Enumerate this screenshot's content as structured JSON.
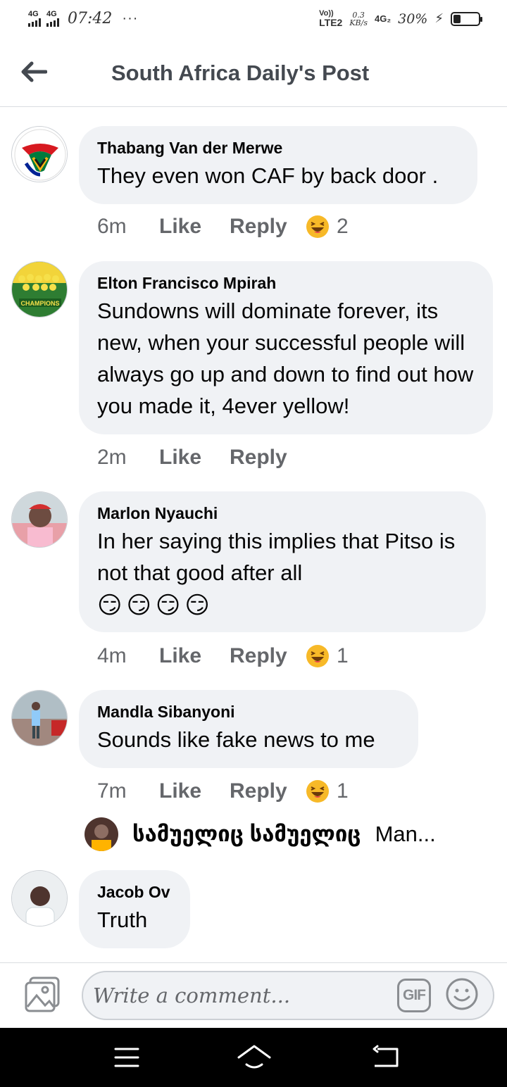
{
  "status_bar": {
    "sim1": "4G",
    "sim2": "4G",
    "time": "07:42",
    "dots": "···",
    "volte_top": "Vo))",
    "volte_bottom": "LTE2",
    "speed_value": "0.3",
    "speed_unit": "KB/s",
    "net_type": "4G₂",
    "battery_percent": "30%",
    "battery_level": 0.3
  },
  "header": {
    "title": "South Africa Daily's Post"
  },
  "comments": [
    {
      "author": "Thabang Van der Merwe",
      "text": "They even won CAF by back door .",
      "time": "6m",
      "like": "Like",
      "reply": "Reply",
      "reaction_count": "2",
      "avatar": "proudly-south-african-logo"
    },
    {
      "author": "Elton Francisco Mpirah",
      "text": "Sundowns will dominate forever, its new, when your successful people will always go up and down to find out how you made it, 4ever yellow!",
      "time": "2m",
      "like": "Like",
      "reply": "Reply",
      "avatar": "champions-team-photo"
    },
    {
      "author": "Marlon Nyauchi",
      "text": "In her saying this implies that Pitso is not that good after all",
      "emojis": [
        "😏",
        "😏",
        "😏",
        "😏"
      ],
      "time": "4m",
      "like": "Like",
      "reply": "Reply",
      "reaction_count": "1",
      "avatar": "man-red-cap-photo"
    },
    {
      "author": "Mandla Sibanyoni",
      "text": "Sounds like fake news to me",
      "time": "7m",
      "like": "Like",
      "reply": "Reply",
      "reaction_count": "1",
      "avatar": "man-walking-photo"
    },
    {
      "author": "Jacob Ov",
      "text": "Truth",
      "avatar": "man-portrait-photo"
    }
  ],
  "reply_preview": {
    "name": "სამუელიც სამუელიც",
    "snippet": "Man..."
  },
  "composer": {
    "placeholder": "Write a comment...",
    "gif_label": "GIF"
  },
  "reaction_icon": "haha-emoji",
  "colors": {
    "bubble": "#f0f2f5",
    "meta": "#65676b",
    "title": "#444950"
  }
}
